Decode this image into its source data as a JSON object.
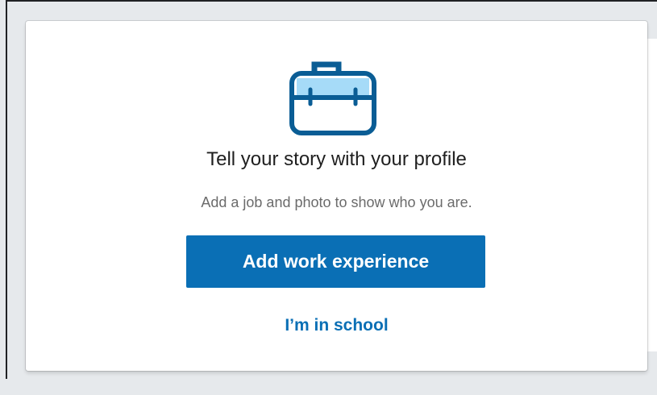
{
  "profile_prompt": {
    "icon": "briefcase-icon",
    "title": "Tell your story with your profile",
    "subtitle": "Add a job and photo to show who you are.",
    "primary_action_label": "Add work experience",
    "secondary_action_label": "I’m in school"
  },
  "colors": {
    "primary": "#0a6fb5",
    "icon_fill": "#a6dbf8",
    "icon_stroke": "#0a5d95",
    "title": "#1f1f1f",
    "subtitle": "#6b6b6b",
    "background": "#e6e9ec"
  }
}
